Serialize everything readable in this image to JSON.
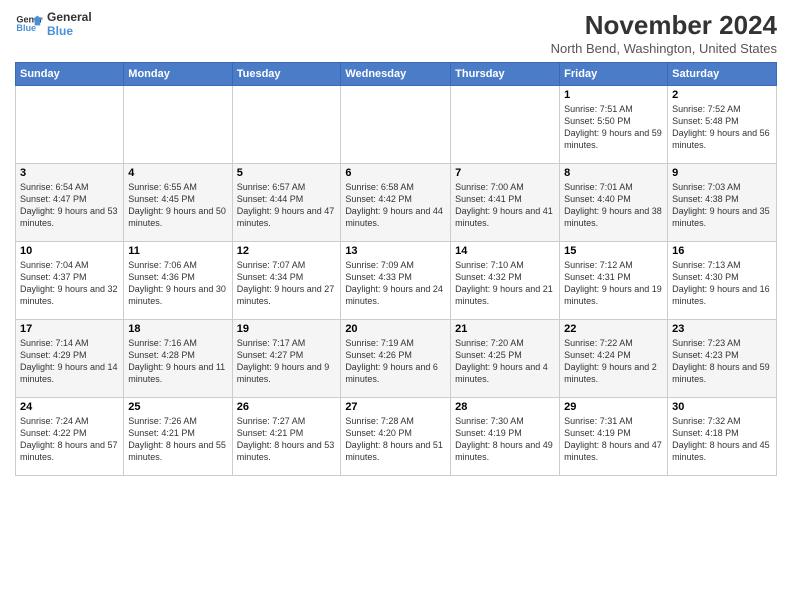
{
  "logo": {
    "line1": "General",
    "line2": "Blue"
  },
  "title": "November 2024",
  "location": "North Bend, Washington, United States",
  "days_of_week": [
    "Sunday",
    "Monday",
    "Tuesday",
    "Wednesday",
    "Thursday",
    "Friday",
    "Saturday"
  ],
  "weeks": [
    [
      {
        "day": "",
        "info": ""
      },
      {
        "day": "",
        "info": ""
      },
      {
        "day": "",
        "info": ""
      },
      {
        "day": "",
        "info": ""
      },
      {
        "day": "",
        "info": ""
      },
      {
        "day": "1",
        "info": "Sunrise: 7:51 AM\nSunset: 5:50 PM\nDaylight: 9 hours and 59 minutes."
      },
      {
        "day": "2",
        "info": "Sunrise: 7:52 AM\nSunset: 5:48 PM\nDaylight: 9 hours and 56 minutes."
      }
    ],
    [
      {
        "day": "3",
        "info": "Sunrise: 6:54 AM\nSunset: 4:47 PM\nDaylight: 9 hours and 53 minutes."
      },
      {
        "day": "4",
        "info": "Sunrise: 6:55 AM\nSunset: 4:45 PM\nDaylight: 9 hours and 50 minutes."
      },
      {
        "day": "5",
        "info": "Sunrise: 6:57 AM\nSunset: 4:44 PM\nDaylight: 9 hours and 47 minutes."
      },
      {
        "day": "6",
        "info": "Sunrise: 6:58 AM\nSunset: 4:42 PM\nDaylight: 9 hours and 44 minutes."
      },
      {
        "day": "7",
        "info": "Sunrise: 7:00 AM\nSunset: 4:41 PM\nDaylight: 9 hours and 41 minutes."
      },
      {
        "day": "8",
        "info": "Sunrise: 7:01 AM\nSunset: 4:40 PM\nDaylight: 9 hours and 38 minutes."
      },
      {
        "day": "9",
        "info": "Sunrise: 7:03 AM\nSunset: 4:38 PM\nDaylight: 9 hours and 35 minutes."
      }
    ],
    [
      {
        "day": "10",
        "info": "Sunrise: 7:04 AM\nSunset: 4:37 PM\nDaylight: 9 hours and 32 minutes."
      },
      {
        "day": "11",
        "info": "Sunrise: 7:06 AM\nSunset: 4:36 PM\nDaylight: 9 hours and 30 minutes."
      },
      {
        "day": "12",
        "info": "Sunrise: 7:07 AM\nSunset: 4:34 PM\nDaylight: 9 hours and 27 minutes."
      },
      {
        "day": "13",
        "info": "Sunrise: 7:09 AM\nSunset: 4:33 PM\nDaylight: 9 hours and 24 minutes."
      },
      {
        "day": "14",
        "info": "Sunrise: 7:10 AM\nSunset: 4:32 PM\nDaylight: 9 hours and 21 minutes."
      },
      {
        "day": "15",
        "info": "Sunrise: 7:12 AM\nSunset: 4:31 PM\nDaylight: 9 hours and 19 minutes."
      },
      {
        "day": "16",
        "info": "Sunrise: 7:13 AM\nSunset: 4:30 PM\nDaylight: 9 hours and 16 minutes."
      }
    ],
    [
      {
        "day": "17",
        "info": "Sunrise: 7:14 AM\nSunset: 4:29 PM\nDaylight: 9 hours and 14 minutes."
      },
      {
        "day": "18",
        "info": "Sunrise: 7:16 AM\nSunset: 4:28 PM\nDaylight: 9 hours and 11 minutes."
      },
      {
        "day": "19",
        "info": "Sunrise: 7:17 AM\nSunset: 4:27 PM\nDaylight: 9 hours and 9 minutes."
      },
      {
        "day": "20",
        "info": "Sunrise: 7:19 AM\nSunset: 4:26 PM\nDaylight: 9 hours and 6 minutes."
      },
      {
        "day": "21",
        "info": "Sunrise: 7:20 AM\nSunset: 4:25 PM\nDaylight: 9 hours and 4 minutes."
      },
      {
        "day": "22",
        "info": "Sunrise: 7:22 AM\nSunset: 4:24 PM\nDaylight: 9 hours and 2 minutes."
      },
      {
        "day": "23",
        "info": "Sunrise: 7:23 AM\nSunset: 4:23 PM\nDaylight: 8 hours and 59 minutes."
      }
    ],
    [
      {
        "day": "24",
        "info": "Sunrise: 7:24 AM\nSunset: 4:22 PM\nDaylight: 8 hours and 57 minutes."
      },
      {
        "day": "25",
        "info": "Sunrise: 7:26 AM\nSunset: 4:21 PM\nDaylight: 8 hours and 55 minutes."
      },
      {
        "day": "26",
        "info": "Sunrise: 7:27 AM\nSunset: 4:21 PM\nDaylight: 8 hours and 53 minutes."
      },
      {
        "day": "27",
        "info": "Sunrise: 7:28 AM\nSunset: 4:20 PM\nDaylight: 8 hours and 51 minutes."
      },
      {
        "day": "28",
        "info": "Sunrise: 7:30 AM\nSunset: 4:19 PM\nDaylight: 8 hours and 49 minutes."
      },
      {
        "day": "29",
        "info": "Sunrise: 7:31 AM\nSunset: 4:19 PM\nDaylight: 8 hours and 47 minutes."
      },
      {
        "day": "30",
        "info": "Sunrise: 7:32 AM\nSunset: 4:18 PM\nDaylight: 8 hours and 45 minutes."
      }
    ]
  ]
}
